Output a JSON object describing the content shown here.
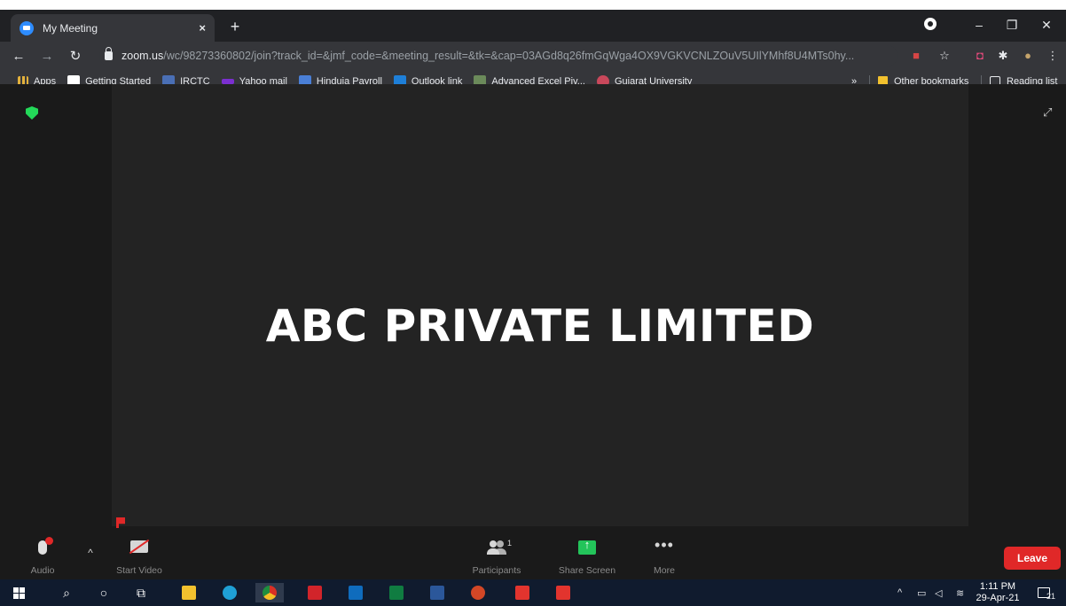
{
  "browser": {
    "tab_title": "My Meeting",
    "tab_close": "×",
    "new_tab": "+",
    "url_host": "zoom.us",
    "url_path": "/wc/98273360802/join?track_id=&jmf_code=&meeting_result=&tk=&cap=03AGd8q26fmGqWga4OX9VGKVCNLZOuV5UIlYMhf8U4MTs0hy..."
  },
  "bookmarks": {
    "items": [
      {
        "label": "Apps",
        "color": "#e2b13c"
      },
      {
        "label": "Getting Started",
        "color": "#ffffff"
      },
      {
        "label": "IRCTC",
        "color": "#4a6fb5"
      },
      {
        "label": "Yahoo mail",
        "color": "#7b2fd0"
      },
      {
        "label": "Hinduja Payroll",
        "color": "#4a7fd6"
      },
      {
        "label": "Outlook link",
        "color": "#1e7fd8"
      },
      {
        "label": "Advanced Excel Piv...",
        "color": "#6b8a5a"
      },
      {
        "label": "Gujarat University",
        "color": "#c9485b"
      }
    ],
    "overflow": "»",
    "other_bookmarks": "Other bookmarks",
    "reading_list": "Reading list"
  },
  "meeting": {
    "title": "ABC PRIVATE LIMITED"
  },
  "controls": {
    "audio_label": "Audio",
    "video_label": "Start Video",
    "participants_label": "Participants",
    "participants_count": "1",
    "share_label": "Share Screen",
    "more_label": "More",
    "leave_label": "Leave"
  },
  "taskbar": {
    "time": "1:11 PM",
    "date": "29-Apr-21",
    "notification_count": "21"
  },
  "colors": {
    "leave": "#e02828",
    "share": "#23c45a",
    "shield": "#23d959"
  }
}
